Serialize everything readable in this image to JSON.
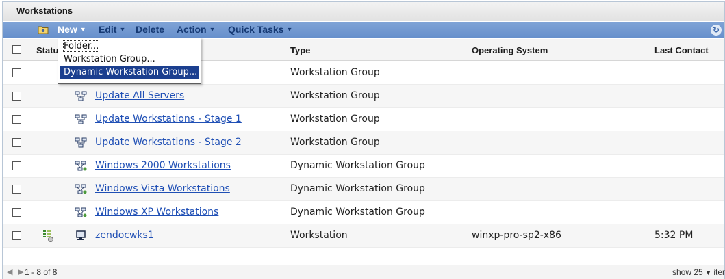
{
  "panel": {
    "title": "Workstations"
  },
  "toolbar": {
    "new_label": "New",
    "edit_label": "Edit",
    "delete_label": "Delete",
    "action_label": "Action",
    "quick_tasks_label": "Quick Tasks"
  },
  "new_menu": {
    "items": [
      "Folder...",
      "Workstation Group...",
      "Dynamic Workstation Group..."
    ],
    "highlighted": "Dynamic Workstation Group..."
  },
  "table": {
    "columns": {
      "status": "Statu",
      "type": "Type",
      "os": "Operating System",
      "last_contact": "Last Contact"
    },
    "rows": [
      {
        "name": "",
        "type": "Workstation Group",
        "os": "",
        "last_contact": "",
        "icon": "workstation-group-icon"
      },
      {
        "name": "Update All Servers",
        "type": "Workstation Group",
        "os": "",
        "last_contact": "",
        "icon": "workstation-group-icon"
      },
      {
        "name": "Update Workstations - Stage 1",
        "type": "Workstation Group",
        "os": "",
        "last_contact": "",
        "icon": "workstation-group-icon"
      },
      {
        "name": "Update Workstations - Stage 2",
        "type": "Workstation Group",
        "os": "",
        "last_contact": "",
        "icon": "workstation-group-icon"
      },
      {
        "name": "Windows 2000 Workstations",
        "type": "Dynamic Workstation Group",
        "os": "",
        "last_contact": "",
        "icon": "dynamic-workstation-group-icon"
      },
      {
        "name": "Windows Vista Workstations",
        "type": "Dynamic Workstation Group",
        "os": "",
        "last_contact": "",
        "icon": "dynamic-workstation-group-icon"
      },
      {
        "name": "Windows XP Workstations",
        "type": "Dynamic Workstation Group",
        "os": "",
        "last_contact": "",
        "icon": "dynamic-workstation-group-icon"
      },
      {
        "name": "zendocwks1",
        "type": "Workstation",
        "os": "winxp-pro-sp2-x86",
        "last_contact": "5:32 PM",
        "icon": "workstation-icon",
        "status_icon": "bundle-status-icon"
      }
    ]
  },
  "footer": {
    "count": "1 - 8 of 8",
    "show_label": "show",
    "page_size": "25",
    "items_label": "items"
  },
  "colors": {
    "toolbar": "#6f96cf",
    "link": "#1f4fb5",
    "menu_highlight": "#1b3f8f"
  }
}
